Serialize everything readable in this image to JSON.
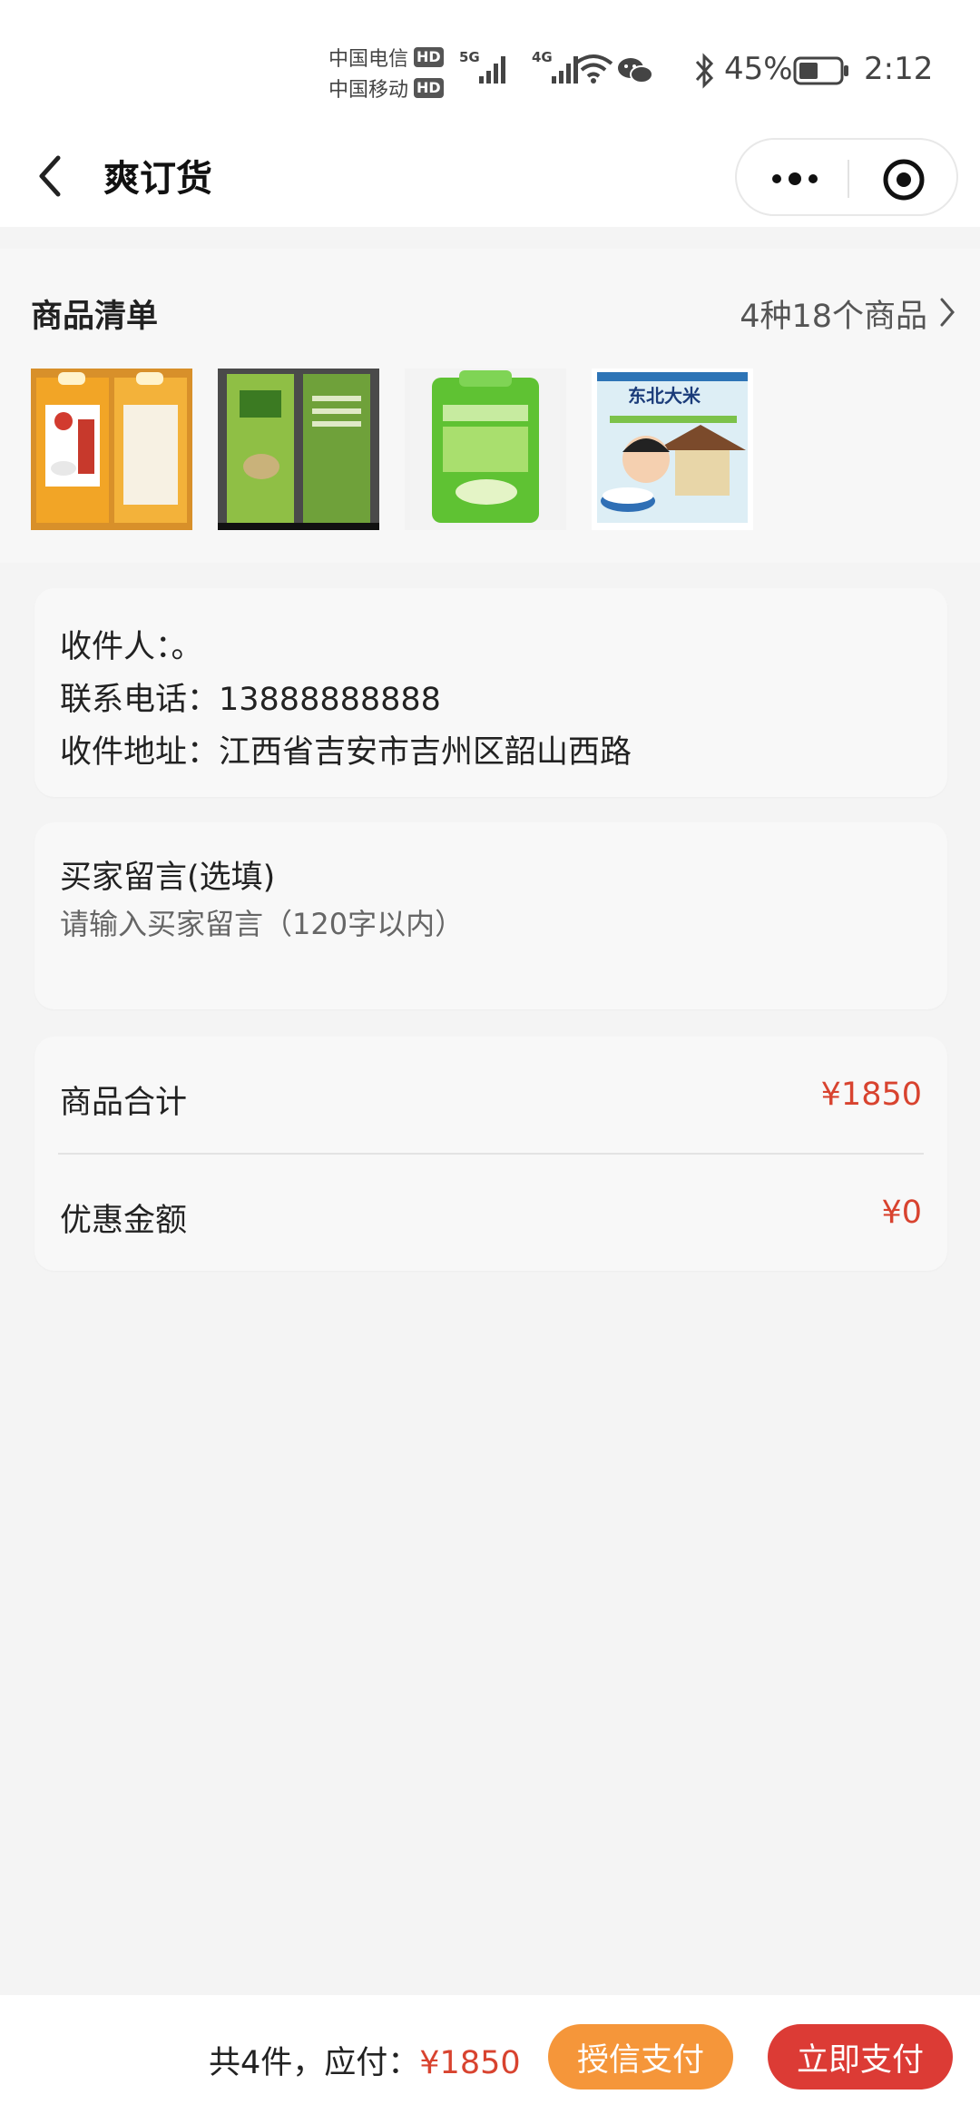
{
  "status_bar": {
    "carrier1": "中国电信",
    "carrier2": "中国移动",
    "hd": "HD",
    "net1": "5G",
    "net2": "4G",
    "battery": "45%",
    "time": "2:12"
  },
  "nav": {
    "title": "爽订货"
  },
  "goods": {
    "title": "商品清单",
    "count": "4种18个商品",
    "thumbnails": [
      {
        "label": "",
        "kind": "orange-rice-bag"
      },
      {
        "label": "",
        "kind": "green-rice-bag"
      },
      {
        "label": "",
        "kind": "light-green-rice-bag"
      },
      {
        "label": "东北大米",
        "kind": "dongbei-rice-bag"
      }
    ]
  },
  "address": {
    "receiver": "收件人：。",
    "phone": "联系电话：13888888888",
    "addr": "收件地址：江西省吉安市吉州区韶山西路"
  },
  "message": {
    "label": "买家留言(选填)",
    "placeholder": "请输入买家留言（120字以内）",
    "value": ""
  },
  "summary": {
    "goods_total_label": "商品合计",
    "goods_total_value": "¥1850",
    "discount_label": "优惠金额",
    "discount_value": "¥0"
  },
  "bottom": {
    "total_prefix": "共4件，应付：",
    "total_price": "¥1850",
    "credit_pay": "授信支付",
    "pay_now": "立即支付"
  },
  "colors": {
    "accent_red": "#d8432f",
    "credit_orange": "#f5963a",
    "pay_red": "#dc3b35"
  }
}
